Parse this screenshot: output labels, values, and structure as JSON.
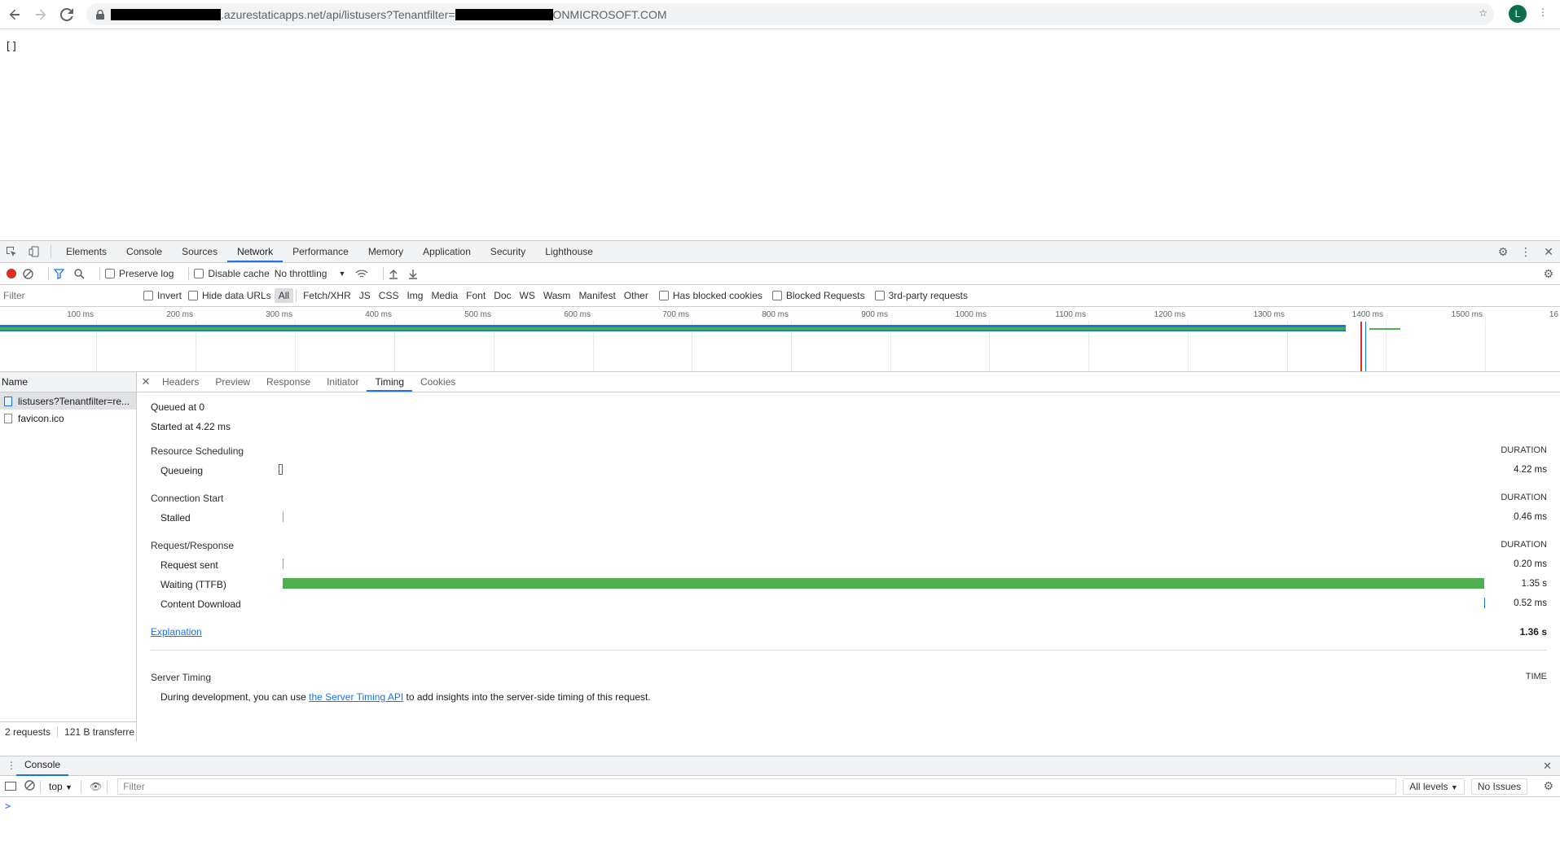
{
  "browser": {
    "url_middle": ".azurestaticapps.net/api/listusers?Tenantfilter=",
    "url_end": "ONMICROSOFT.COM",
    "avatar_letter": "L"
  },
  "page": {
    "body_text": "[]"
  },
  "devtools": {
    "tabs": [
      "Elements",
      "Console",
      "Sources",
      "Network",
      "Performance",
      "Memory",
      "Application",
      "Security",
      "Lighthouse"
    ],
    "active_tab": "Network",
    "toolbar": {
      "preserve_log": "Preserve log",
      "disable_cache": "Disable cache",
      "throttling": "No throttling"
    },
    "filterbar": {
      "placeholder": "Filter",
      "invert": "Invert",
      "hide_data_urls": "Hide data URLs",
      "types": [
        "All",
        "Fetch/XHR",
        "JS",
        "CSS",
        "Img",
        "Media",
        "Font",
        "Doc",
        "WS",
        "Wasm",
        "Manifest",
        "Other"
      ],
      "has_blocked_cookies": "Has blocked cookies",
      "blocked_requests": "Blocked Requests",
      "third_party": "3rd-party requests"
    },
    "overview_ticks": [
      "100 ms",
      "200 ms",
      "300 ms",
      "400 ms",
      "500 ms",
      "600 ms",
      "700 ms",
      "800 ms",
      "900 ms",
      "1000 ms",
      "1100 ms",
      "1200 ms",
      "1300 ms",
      "1400 ms",
      "1500 ms",
      "16"
    ],
    "names_header": "Name",
    "requests": [
      {
        "name": "listusers?Tenantfilter=re...",
        "selected": true
      },
      {
        "name": "favicon.ico",
        "selected": false
      }
    ],
    "footer": {
      "requests": "2 requests",
      "transferred": "121 B transferre"
    },
    "detail_tabs": [
      "Headers",
      "Preview",
      "Response",
      "Initiator",
      "Timing",
      "Cookies"
    ],
    "active_detail_tab": "Timing",
    "timing": {
      "queued_at": "Queued at 0",
      "started_at": "Started at 4.22 ms",
      "resource_scheduling": "Resource Scheduling",
      "duration_label": "DURATION",
      "queueing": "Queueing",
      "queueing_dur": "4.22 ms",
      "connection_start": "Connection Start",
      "stalled": "Stalled",
      "stalled_dur": "0.46 ms",
      "request_response": "Request/Response",
      "request_sent": "Request sent",
      "request_sent_dur": "0.20 ms",
      "waiting": "Waiting (TTFB)",
      "waiting_dur": "1.35 s",
      "content_download": "Content Download",
      "content_download_dur": "0.52 ms",
      "explanation": "Explanation",
      "total": "1.36 s",
      "server_timing": "Server Timing",
      "time_label": "TIME",
      "server_text_before": "During development, you can use ",
      "server_link": "the Server Timing API",
      "server_text_after": " to add insights into the server-side timing of this request."
    },
    "console": {
      "tab": "Console",
      "context": "top",
      "filter_placeholder": "Filter",
      "levels": "All levels",
      "issues": "No Issues",
      "prompt": ">"
    },
    "colors": {
      "accent": "#1a73e8",
      "waiting_bar": "#4caf50",
      "record": "#d93025"
    }
  }
}
